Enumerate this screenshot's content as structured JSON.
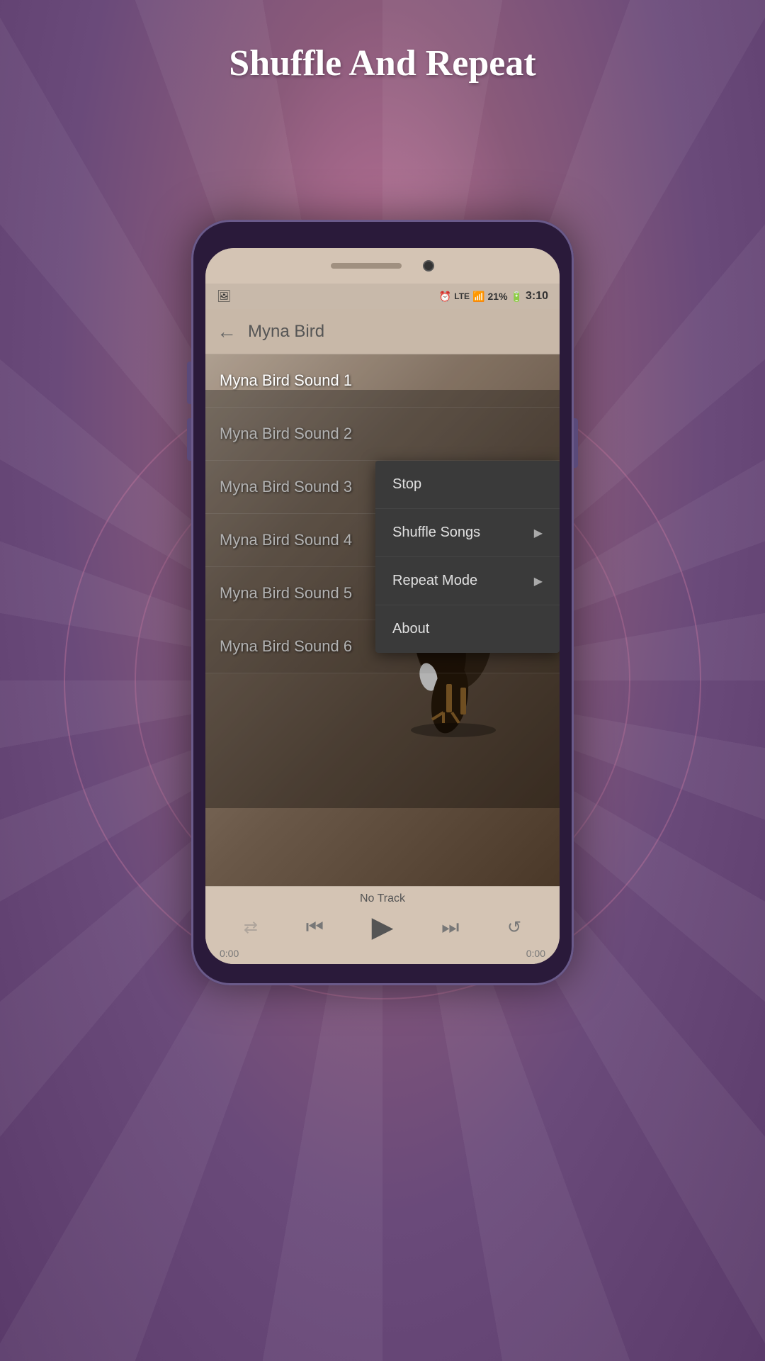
{
  "page": {
    "title": "Shuffle And Repeat",
    "background": {
      "primary_color": "#7a5a8a",
      "secondary_color": "#c97aa0"
    }
  },
  "status_bar": {
    "icons": [
      "alarm",
      "lte",
      "wifi",
      "signal",
      "battery"
    ],
    "battery_percent": "21%",
    "time": "3:10"
  },
  "app_header": {
    "back_label": "←",
    "title": "Myna Bird"
  },
  "song_list": {
    "items": [
      {
        "id": 1,
        "label": "Myna Bird Sound 1"
      },
      {
        "id": 2,
        "label": "Myna Bird Sound 2"
      },
      {
        "id": 3,
        "label": "Myna Bird Sound 3"
      },
      {
        "id": 4,
        "label": "Myna Bird Sound 4"
      },
      {
        "id": 5,
        "label": "Myna Bird Sound 5"
      },
      {
        "id": 6,
        "label": "Myna Bird Sound 6"
      }
    ]
  },
  "bottom_player": {
    "track_name": "No Track",
    "time_start": "0:00",
    "time_end": "0:00",
    "buttons": {
      "shuffle": "⇄",
      "prev": "⏮",
      "play": "▶",
      "next": "⏭",
      "repeat": "↺"
    }
  },
  "context_menu": {
    "items": [
      {
        "id": "stop",
        "label": "Stop",
        "has_arrow": false
      },
      {
        "id": "shuffle-songs",
        "label": "Shuffle Songs",
        "has_arrow": true
      },
      {
        "id": "repeat-mode",
        "label": "Repeat Mode",
        "has_arrow": true
      },
      {
        "id": "about",
        "label": "About",
        "has_arrow": false
      }
    ]
  }
}
